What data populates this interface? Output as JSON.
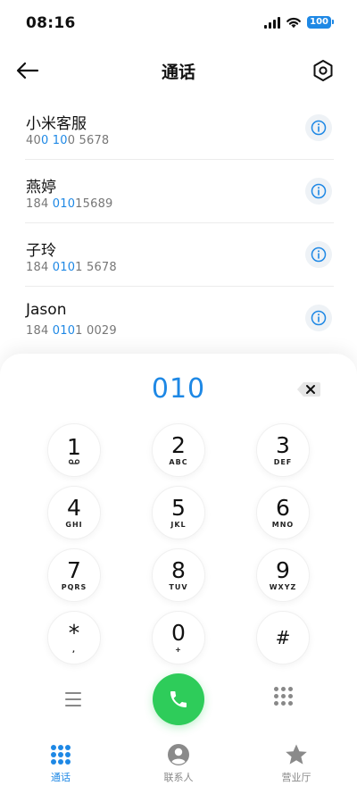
{
  "status_bar": {
    "time": "08:16",
    "battery": "100",
    "icons": [
      "signal-icon",
      "wifi-icon",
      "battery-icon"
    ]
  },
  "header": {
    "title": "通话",
    "back_icon": "back-arrow-icon",
    "settings_icon": "settings-icon"
  },
  "contacts": [
    {
      "name": "小米客服",
      "number_parts": [
        "40",
        "0 10",
        "0 5678"
      ]
    },
    {
      "name": "燕婷",
      "number_parts": [
        "184 ",
        "010",
        "15689"
      ]
    },
    {
      "name": "子玲",
      "number_parts": [
        "184 ",
        "010",
        "1 5678"
      ]
    },
    {
      "name": "Jason",
      "number_parts": [
        "184 ",
        "010",
        "1 0029"
      ]
    }
  ],
  "dialer": {
    "input": "010",
    "keys": [
      {
        "digit": "1",
        "letters": "voicemail"
      },
      {
        "digit": "2",
        "letters": "ABC"
      },
      {
        "digit": "3",
        "letters": "DEF"
      },
      {
        "digit": "4",
        "letters": "GHI"
      },
      {
        "digit": "5",
        "letters": "JKL"
      },
      {
        "digit": "6",
        "letters": "MNO"
      },
      {
        "digit": "7",
        "letters": "PQRS"
      },
      {
        "digit": "8",
        "letters": "TUV"
      },
      {
        "digit": "9",
        "letters": "WXYZ"
      },
      {
        "digit": "*",
        "letters": ","
      },
      {
        "digit": "0",
        "letters": "+"
      },
      {
        "digit": "#",
        "letters": ""
      }
    ]
  },
  "bottom_nav": [
    {
      "label": "通话",
      "icon": "dialpad-icon",
      "active": true
    },
    {
      "label": "联系人",
      "icon": "person-icon",
      "active": false
    },
    {
      "label": "营业厅",
      "icon": "star-icon",
      "active": false
    }
  ],
  "colors": {
    "accent": "#1e88e5",
    "call_button": "#2ecc5a"
  }
}
